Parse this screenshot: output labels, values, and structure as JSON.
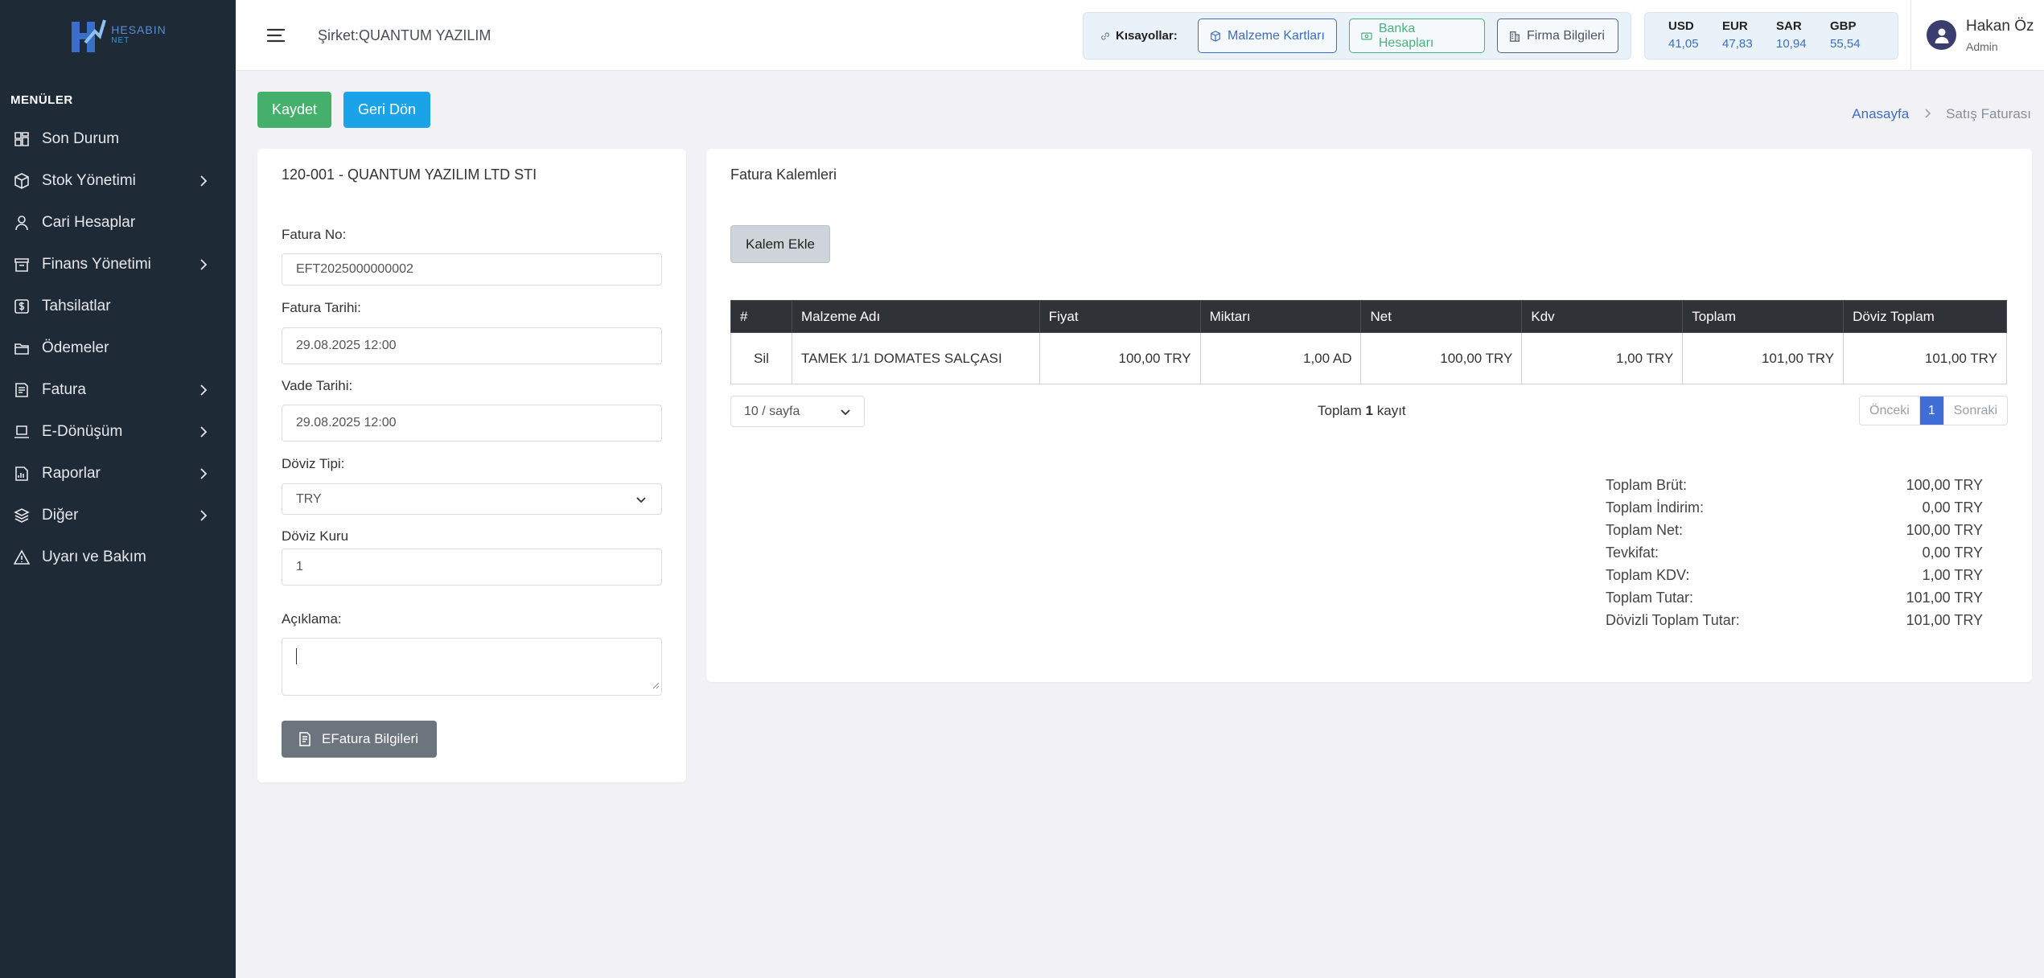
{
  "brand": {
    "name": "HESABIN",
    "sub": "NET"
  },
  "sidebar": {
    "menu_title": "MENÜLER",
    "items": [
      {
        "label": "Son Durum",
        "icon": "dashboard-icon",
        "has_submenu": false
      },
      {
        "label": "Stok Yönetimi",
        "icon": "box-icon",
        "has_submenu": true
      },
      {
        "label": "Cari Hesaplar",
        "icon": "user-icon",
        "has_submenu": false
      },
      {
        "label": "Finans Yönetimi",
        "icon": "archive-icon",
        "has_submenu": true
      },
      {
        "label": "Tahsilatlar",
        "icon": "dollar-icon",
        "has_submenu": false
      },
      {
        "label": "Ödemeler",
        "icon": "folder-icon",
        "has_submenu": false
      },
      {
        "label": "Fatura",
        "icon": "receipt-icon",
        "has_submenu": true
      },
      {
        "label": "E-Dönüşüm",
        "icon": "laptop-icon",
        "has_submenu": true
      },
      {
        "label": "Raporlar",
        "icon": "report-icon",
        "has_submenu": true
      },
      {
        "label": "Diğer",
        "icon": "layers-icon",
        "has_submenu": true
      },
      {
        "label": "Uyarı ve Bakım",
        "icon": "warning-icon",
        "has_submenu": false
      }
    ]
  },
  "header": {
    "company": "Şirket:QUANTUM YAZILIM",
    "shortcuts_label": "Kısayollar:",
    "shortcuts": [
      {
        "label": "Malzeme Kartları",
        "icon": "cube-icon"
      },
      {
        "label": "Banka Hesapları",
        "icon": "banknote-icon"
      },
      {
        "label": "Firma Bilgileri",
        "icon": "building-icon"
      }
    ],
    "rates": [
      {
        "code": "USD",
        "value": "41,05"
      },
      {
        "code": "EUR",
        "value": "47,83"
      },
      {
        "code": "SAR",
        "value": "10,94"
      },
      {
        "code": "GBP",
        "value": "55,54"
      }
    ],
    "user": {
      "name": "Hakan Öz",
      "role": "Admin"
    }
  },
  "actions": {
    "save": "Kaydet",
    "back": "Geri Dön"
  },
  "breadcrumb": {
    "home": "Anasayfa",
    "current": "Satış Faturası"
  },
  "invoice": {
    "account": "120-001 - QUANTUM YAZILIM LTD STI",
    "fields": {
      "no_label": "Fatura No:",
      "no": "EFT2025000000002",
      "date_label": "Fatura Tarihi:",
      "date": "29.08.2025 12:00",
      "due_label": "Vade Tarihi:",
      "due": "29.08.2025 12:00",
      "currency_label": "Döviz Tipi:",
      "currency": "TRY",
      "rate_label": "Döviz Kuru",
      "rate": "1",
      "note_label": "Açıklama:",
      "note": ""
    },
    "efatura_button": "EFatura Bilgileri"
  },
  "items": {
    "title": "Fatura Kalemleri",
    "add_button": "Kalem Ekle",
    "columns": [
      "#",
      "Malzeme Adı",
      "Fiyat",
      "Miktarı",
      "Net",
      "Kdv",
      "Toplam",
      "Döviz Toplam"
    ],
    "rows": [
      {
        "action": "Sil",
        "name": "TAMEK 1/1 DOMATES SALÇASI",
        "price": "100,00 TRY",
        "qty": "1,00 AD",
        "net": "100,00 TRY",
        "kdv": "1,00 TRY",
        "total": "101,00 TRY",
        "fx_total": "101,00 TRY"
      }
    ],
    "page_size": "10 / sayfa",
    "record_prefix": "Toplam",
    "record_count": "1",
    "record_suffix": "kayıt",
    "pager": {
      "prev": "Önceki",
      "current": "1",
      "next": "Sonraki"
    }
  },
  "totals": [
    {
      "label": "Toplam Brüt:",
      "value": "100,00 TRY"
    },
    {
      "label": "Toplam İndirim:",
      "value": "0,00 TRY"
    },
    {
      "label": "Toplam Net:",
      "value": "100,00 TRY"
    },
    {
      "label": "Tevkifat:",
      "value": "0,00 TRY"
    },
    {
      "label": "Toplam KDV:",
      "value": "1,00 TRY"
    },
    {
      "label": "Toplam Tutar:",
      "value": "101,00 TRY"
    },
    {
      "label": "Dövizli Toplam Tutar:",
      "value": "101,00 TRY"
    }
  ],
  "colors": {
    "sidebar": "#1f2a37",
    "save": "#45b06b",
    "back": "#1aa3e8",
    "accent": "#3d6ebf",
    "delete": "#e0535f"
  }
}
